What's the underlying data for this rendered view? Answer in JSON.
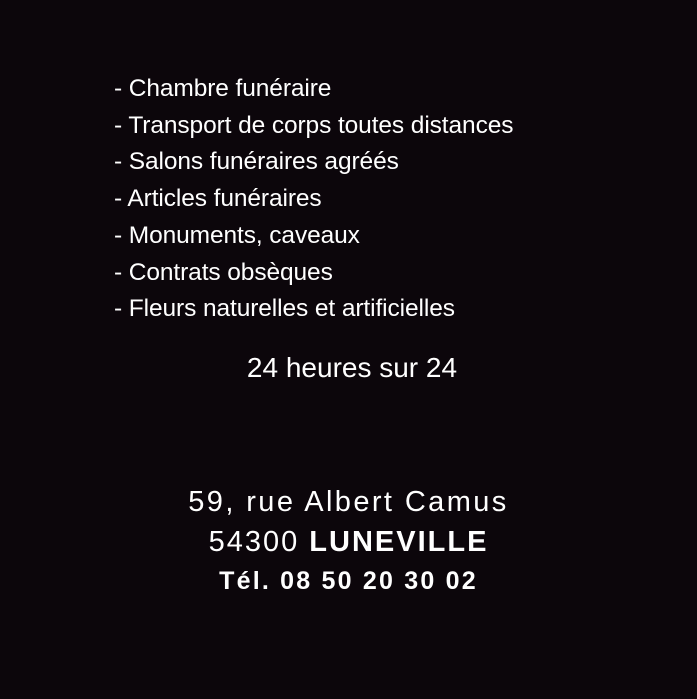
{
  "services": [
    "- Chambre funéraire",
    "- Transport de corps toutes distances",
    "- Salons funéraires agréés",
    "- Articles funéraires",
    "- Monuments, caveaux",
    "- Contrats obsèques",
    "- Fleurs naturelles et artificielles"
  ],
  "availability": "24 heures sur 24",
  "address": {
    "street": "59, rue Albert Camus",
    "postal_code": "54300",
    "city": "LUNEVILLE"
  },
  "phone": "Tél. 08 50 20 30 02",
  "colors": {
    "background": "#0c060b",
    "text": "#ffffff"
  }
}
